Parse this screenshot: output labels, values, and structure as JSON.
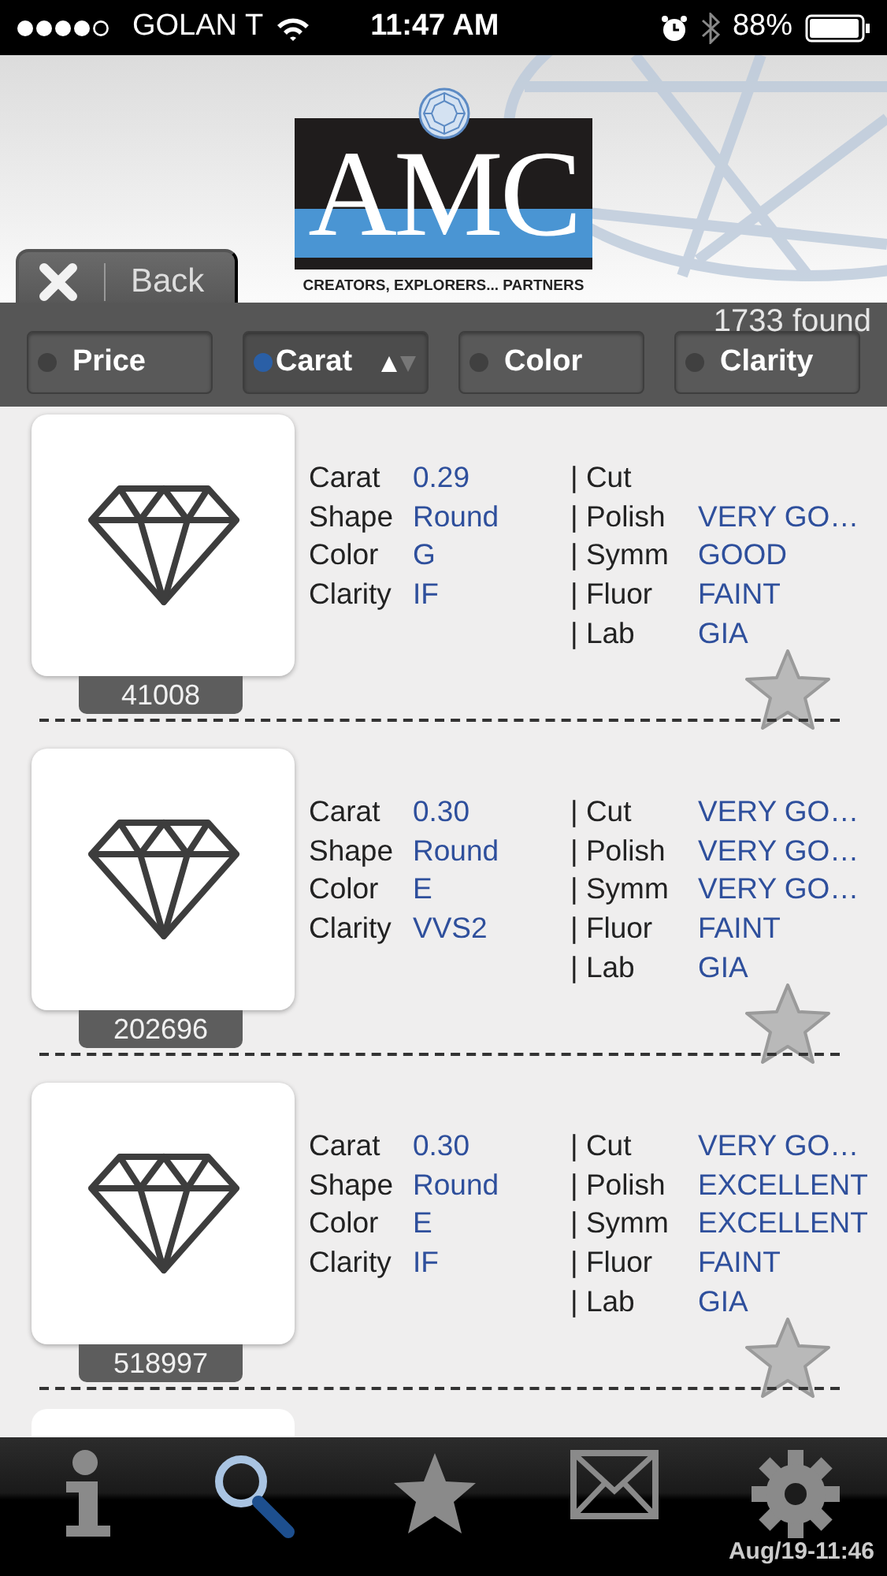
{
  "status_bar": {
    "carrier": "GOLAN T",
    "time": "11:47 AM",
    "battery": "88%"
  },
  "header": {
    "logo": "AMC",
    "tagline": "CREATORS, EXPLORERS... PARTNERS",
    "back": "Back"
  },
  "found": "1733 found",
  "sort_options": [
    {
      "label": "Price",
      "selected": false
    },
    {
      "label": "Carat",
      "selected": true
    },
    {
      "label": "Color",
      "selected": false
    },
    {
      "label": "Clarity",
      "selected": false
    }
  ],
  "diamonds": [
    {
      "id": "41008",
      "favorite": false,
      "left": [
        {
          "label": "Carat",
          "value": "0.29"
        },
        {
          "label": "Shape",
          "value": "Round"
        },
        {
          "label": "Color",
          "value": "G"
        },
        {
          "label": "Clarity",
          "value": "IF"
        }
      ],
      "right": [
        {
          "label": "| Cut"
        },
        {
          "label": "| Polish",
          "value": "VERY GO…"
        },
        {
          "label": "| Symm",
          "value": "GOOD"
        },
        {
          "label": "| Fluor",
          "value": "FAINT"
        },
        {
          "label": "| Lab",
          "value": "GIA"
        }
      ]
    },
    {
      "id": "202696",
      "favorite": false,
      "left": [
        {
          "label": "Carat",
          "value": "0.30"
        },
        {
          "label": "Shape",
          "value": "Round"
        },
        {
          "label": "Color",
          "value": "E"
        },
        {
          "label": "Clarity",
          "value": "VVS2"
        }
      ],
      "right": [
        {
          "label": "| Cut",
          "value": "VERY GO…"
        },
        {
          "label": "| Polish",
          "value": "VERY GO…"
        },
        {
          "label": "| Symm",
          "value": "VERY GO…"
        },
        {
          "label": "| Fluor",
          "value": "FAINT"
        },
        {
          "label": "| Lab",
          "value": "GIA"
        }
      ]
    },
    {
      "id": "518997",
      "favorite": false,
      "left": [
        {
          "label": "Carat",
          "value": "0.30"
        },
        {
          "label": "Shape",
          "value": "Round"
        },
        {
          "label": "Color",
          "value": "E"
        },
        {
          "label": "Clarity",
          "value": "IF"
        }
      ],
      "right": [
        {
          "label": "| Cut",
          "value": "VERY GO…"
        },
        {
          "label": "| Polish",
          "value": "EXCELLENT"
        },
        {
          "label": "| Symm",
          "value": "EXCELLENT"
        },
        {
          "label": "| Fluor",
          "value": "FAINT"
        },
        {
          "label": "| Lab",
          "value": "GIA"
        }
      ]
    }
  ],
  "tab_bar": {
    "tabs": [
      {
        "kind": "info",
        "selected": false
      },
      {
        "kind": "search",
        "selected": true
      },
      {
        "kind": "favorites",
        "selected": false
      },
      {
        "kind": "mail",
        "selected": false
      },
      {
        "kind": "settings",
        "selected": false
      }
    ],
    "timestamp": "Aug/19-11:46"
  }
}
